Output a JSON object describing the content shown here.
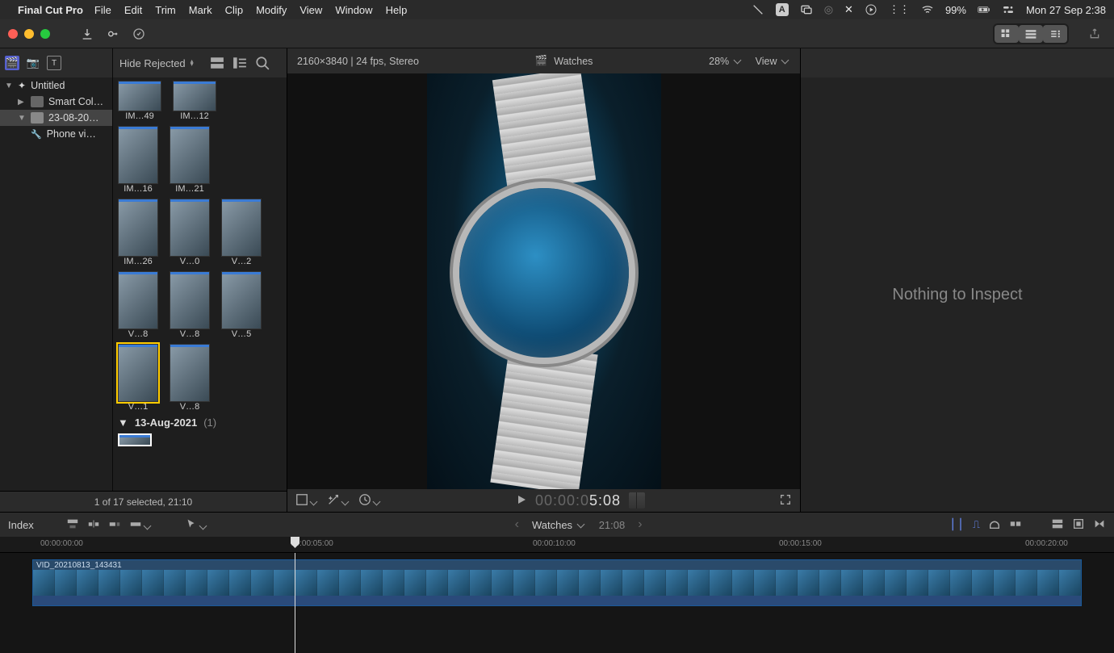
{
  "menubar": {
    "app": "Final Cut Pro",
    "items": [
      "File",
      "Edit",
      "Trim",
      "Mark",
      "Clip",
      "Modify",
      "View",
      "Window",
      "Help"
    ],
    "battery": "99%",
    "clock": "Mon 27 Sep  2:38"
  },
  "library": {
    "hide_rejected": "Hide Rejected",
    "sidebar": {
      "rows": [
        {
          "label": "Untitled",
          "icon": "library",
          "expanded": true,
          "indent": 0
        },
        {
          "label": "Smart Col…",
          "icon": "folder",
          "expanded": false,
          "indent": 1
        },
        {
          "label": "23-08-20…",
          "icon": "event",
          "selected": true,
          "indent": 1
        },
        {
          "label": "Phone vi…",
          "icon": "keyword",
          "indent": 2
        }
      ]
    },
    "clips": {
      "row1": [
        {
          "n": "IM…49"
        },
        {
          "n": "IM…12"
        }
      ],
      "row2": [
        {
          "n": "IM…16"
        },
        {
          "n": "IM…21"
        }
      ],
      "row3": [
        {
          "n": "IM…26"
        },
        {
          "n": "V…0"
        },
        {
          "n": "V…2"
        }
      ],
      "row4": [
        {
          "n": "V…8"
        },
        {
          "n": "V…8"
        },
        {
          "n": "V…5"
        }
      ],
      "row5": [
        {
          "n": "V…1"
        },
        {
          "n": "V…8"
        }
      ]
    },
    "group_date": "13-Aug-2021",
    "group_count": "(1)",
    "status": "1 of 17 selected, 21:10"
  },
  "viewer": {
    "info": "2160×3840 | 24 fps, Stereo",
    "title": "Watches",
    "zoom": "28%",
    "view_label": "View",
    "timecode_gray": "00:00:0",
    "timecode_frame": "5:08"
  },
  "inspector": {
    "empty": "Nothing to Inspect"
  },
  "timeline": {
    "index": "Index",
    "title": "Watches",
    "duration": "21:08",
    "ruler": [
      "00:00:00:00",
      "00:00:05:00",
      "00:00:10:00",
      "00:00:15:00",
      "00:00:20:00"
    ],
    "clip_name": "VID_20210813_143431"
  }
}
